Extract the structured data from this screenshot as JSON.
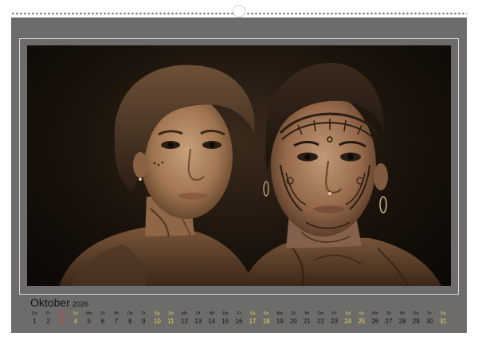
{
  "calendar": {
    "month": "Oktober",
    "year": "2026",
    "days": [
      {
        "wd": "Do",
        "n": "1",
        "type": "weekday"
      },
      {
        "wd": "Fr",
        "n": "2",
        "type": "weekday"
      },
      {
        "wd": "Sa",
        "n": "3",
        "type": "holiday"
      },
      {
        "wd": "So",
        "n": "4",
        "type": "sun"
      },
      {
        "wd": "Mo",
        "n": "5",
        "type": "weekday"
      },
      {
        "wd": "Di",
        "n": "6",
        "type": "weekday"
      },
      {
        "wd": "Mi",
        "n": "7",
        "type": "weekday"
      },
      {
        "wd": "Do",
        "n": "8",
        "type": "weekday"
      },
      {
        "wd": "Fr",
        "n": "9",
        "type": "weekday"
      },
      {
        "wd": "Sa",
        "n": "10",
        "type": "sat"
      },
      {
        "wd": "So",
        "n": "11",
        "type": "sun"
      },
      {
        "wd": "Mo",
        "n": "12",
        "type": "weekday"
      },
      {
        "wd": "Di",
        "n": "13",
        "type": "weekday"
      },
      {
        "wd": "Mi",
        "n": "14",
        "type": "weekday"
      },
      {
        "wd": "Do",
        "n": "15",
        "type": "weekday"
      },
      {
        "wd": "Fr",
        "n": "16",
        "type": "weekday"
      },
      {
        "wd": "Sa",
        "n": "17",
        "type": "sat"
      },
      {
        "wd": "So",
        "n": "18",
        "type": "sun"
      },
      {
        "wd": "Mo",
        "n": "19",
        "type": "weekday"
      },
      {
        "wd": "Di",
        "n": "20",
        "type": "weekday"
      },
      {
        "wd": "Mi",
        "n": "21",
        "type": "weekday"
      },
      {
        "wd": "Do",
        "n": "22",
        "type": "weekday"
      },
      {
        "wd": "Fr",
        "n": "23",
        "type": "weekday"
      },
      {
        "wd": "Sa",
        "n": "24",
        "type": "sat"
      },
      {
        "wd": "So",
        "n": "25",
        "type": "sun"
      },
      {
        "wd": "Mo",
        "n": "26",
        "type": "weekday"
      },
      {
        "wd": "Di",
        "n": "27",
        "type": "weekday"
      },
      {
        "wd": "Mi",
        "n": "28",
        "type": "weekday"
      },
      {
        "wd": "Do",
        "n": "29",
        "type": "weekday"
      },
      {
        "wd": "Fr",
        "n": "30",
        "type": "weekday"
      },
      {
        "wd": "Sa",
        "n": "31",
        "type": "sat"
      }
    ]
  },
  "colors": {
    "panel": "#6d6c6b",
    "weekend": "#e8d24a",
    "holiday": "#ff3a2a",
    "photo_tone": "#3a2a1c"
  },
  "photo": {
    "subject": "sepia portrait of two young women, right one with tattooed face"
  }
}
